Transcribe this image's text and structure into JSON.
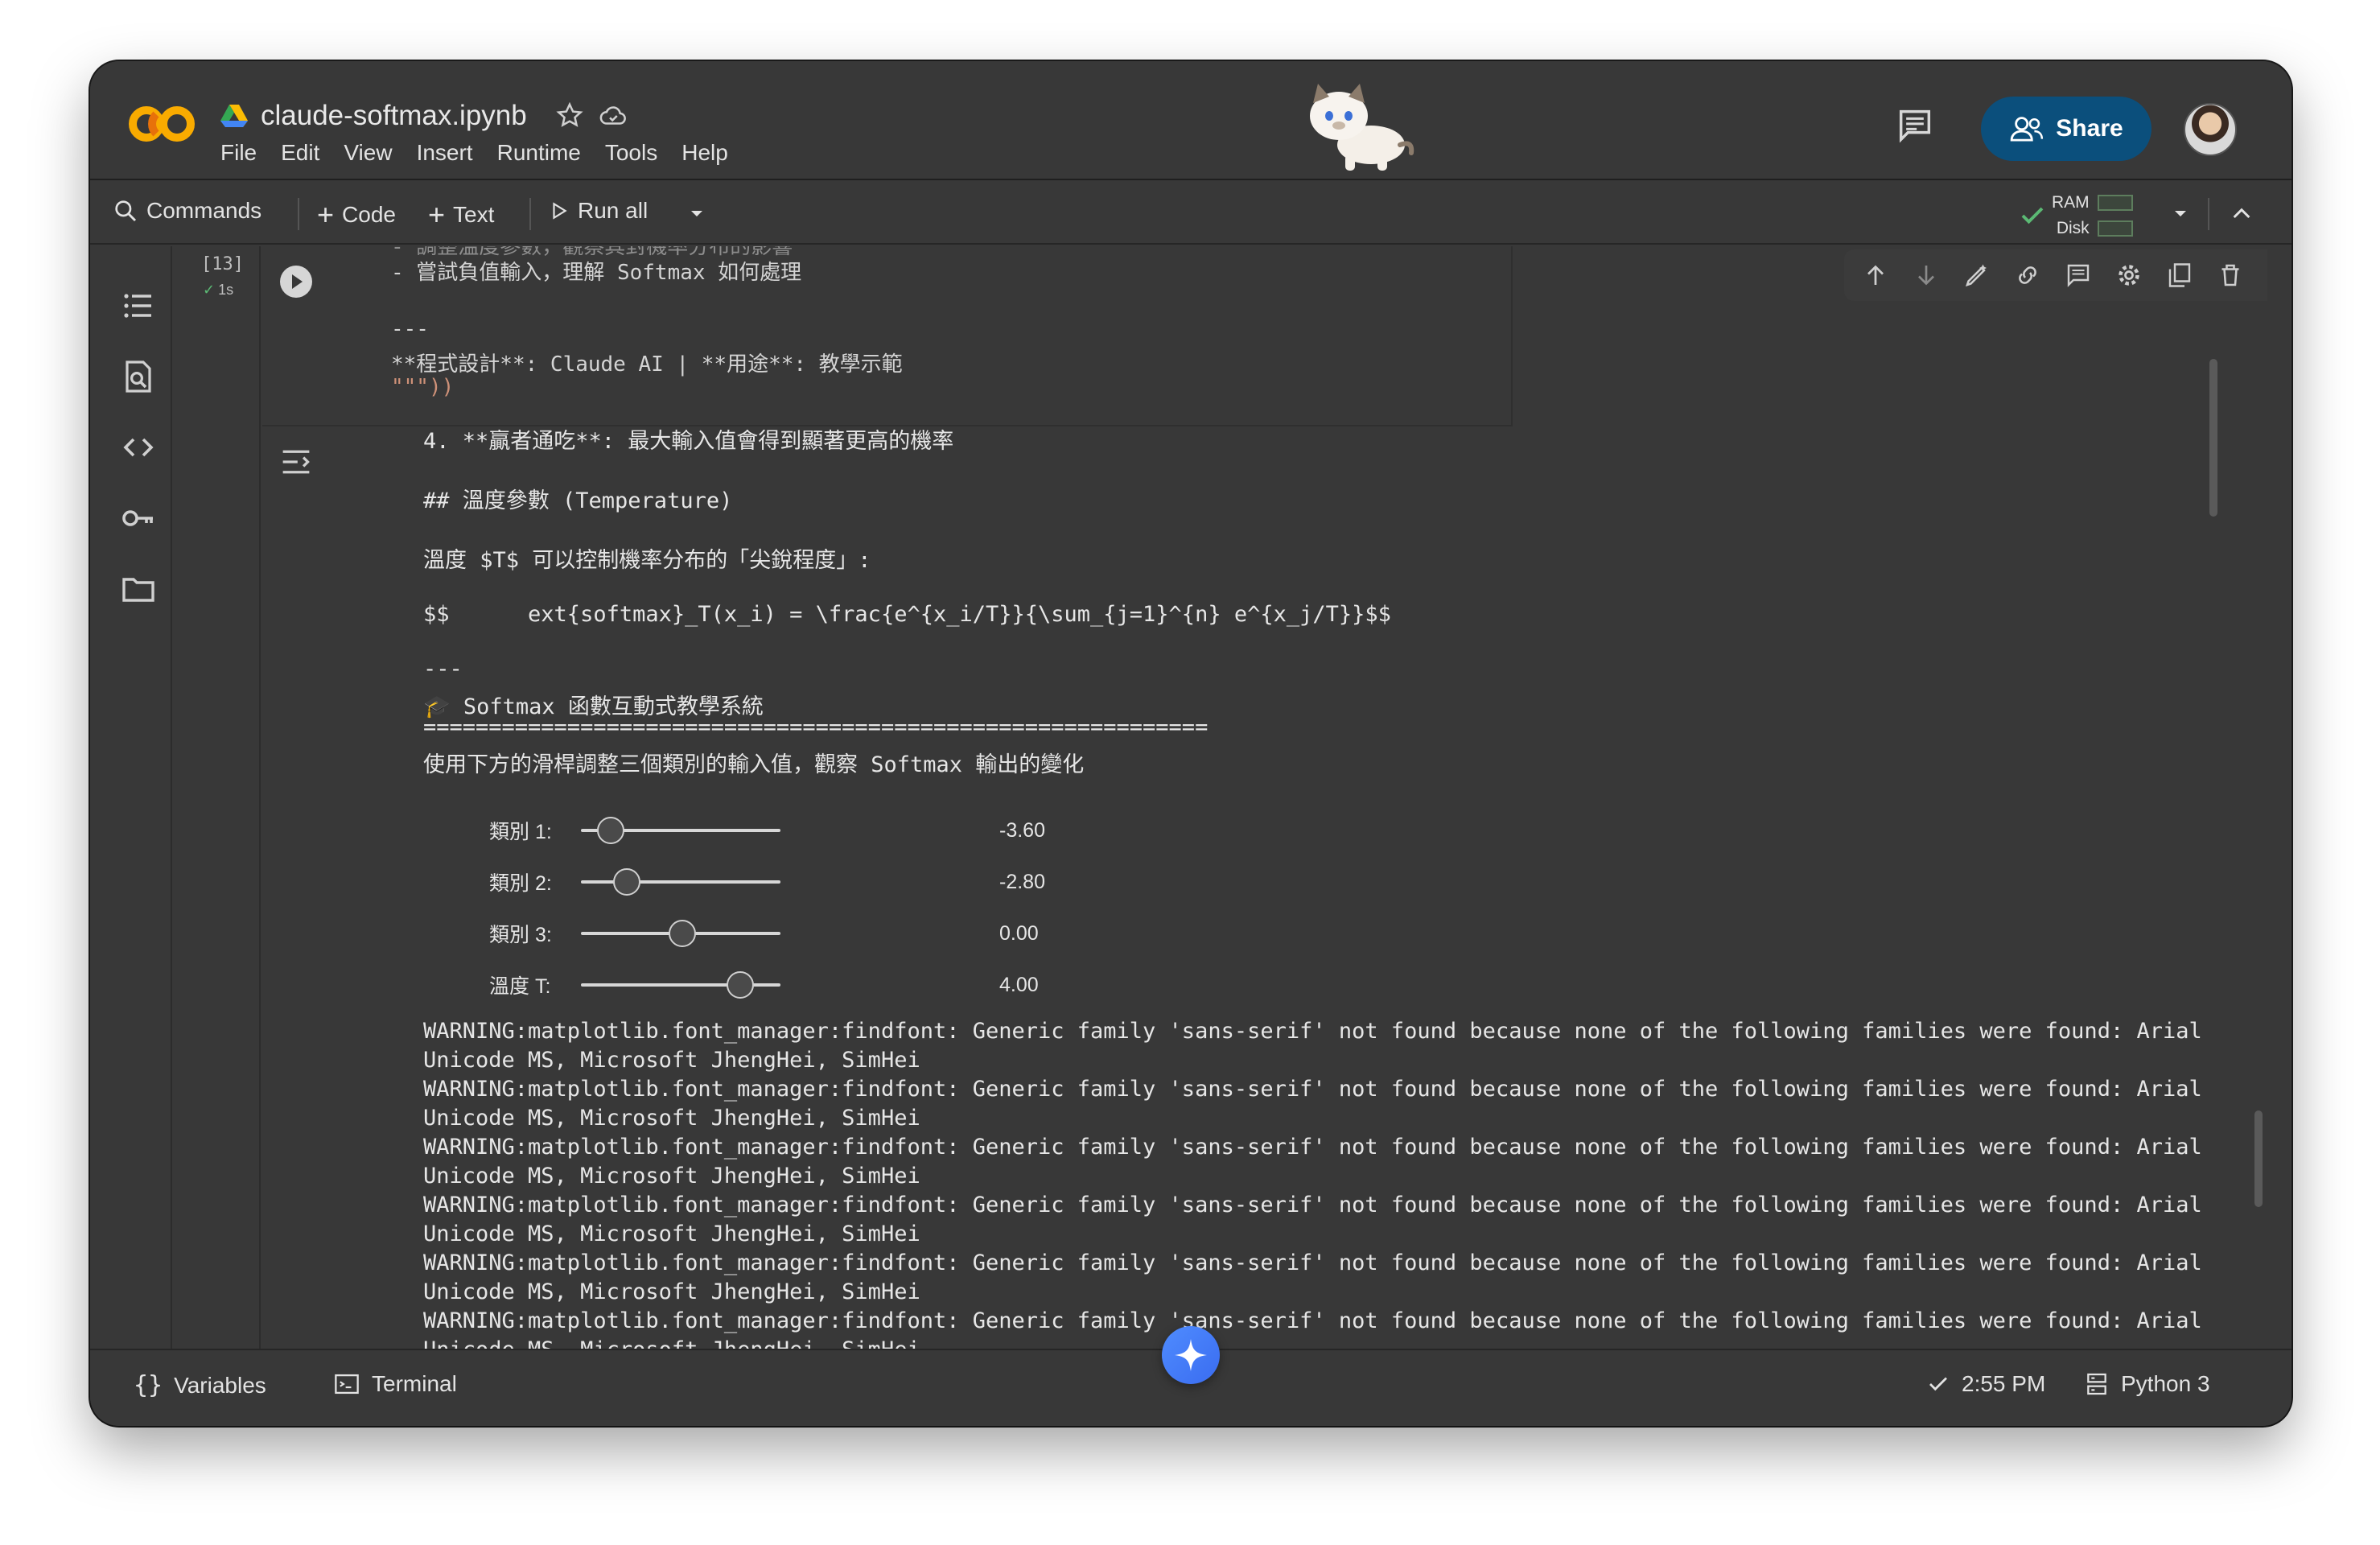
{
  "app": {
    "notebook_title": "claude-softmax.ipynb",
    "menu": [
      "File",
      "Edit",
      "View",
      "Insert",
      "Runtime",
      "Tools",
      "Help"
    ],
    "share_label": "Share"
  },
  "toolbar": {
    "commands_label": "Commands",
    "code_label": "Code",
    "text_label": "Text",
    "run_all_label": "Run all",
    "ram_label": "RAM",
    "disk_label": "Disk"
  },
  "cell": {
    "exec_count": "[13]",
    "exec_time": "1s",
    "code_lines": [
      "- 調整溫度參數，觀察其對機率分布的影響",
      "- 嘗試負值輸入，理解 Softmax 如何處理",
      "",
      "---",
      "**程式設計**: Claude AI | **用途**: 教學示範",
      "\"\"\"))"
    ]
  },
  "output": {
    "lines": [
      "4. **贏者通吃**: 最大輸入值會得到顯著更高的機率",
      "## 溫度參數 (Temperature)",
      "溫度 $T$ 可以控制機率分布的「尖銳程度」:",
      "$$      ext{softmax}_T(x_i) = \\frac{e^{x_i/T}}{\\sum_{j=1}^{n} e^{x_j/T}}$$",
      "---",
      "🎓 Softmax 函數互動式教學系統",
      "============================================================",
      "使用下方的滑桿調整三個類別的輸入值，觀察 Softmax 輸出的變化"
    ],
    "sliders": [
      {
        "label": "類別 1:",
        "value": "-3.60",
        "position": 0.15
      },
      {
        "label": "類別 2:",
        "value": "-2.80",
        "position": 0.23
      },
      {
        "label": "類別 3:",
        "value": "0.00",
        "position": 0.51
      },
      {
        "label": "溫度 T:",
        "value": "4.00",
        "position": 0.8
      }
    ],
    "warnings": [
      "WARNING:matplotlib.font_manager:findfont: Generic family 'sans-serif' not found because none of the following families were found: Arial",
      "Unicode MS, Microsoft JhengHei, SimHei",
      "WARNING:matplotlib.font_manager:findfont: Generic family 'sans-serif' not found because none of the following families were found: Arial",
      "Unicode MS, Microsoft JhengHei, SimHei",
      "WARNING:matplotlib.font_manager:findfont: Generic family 'sans-serif' not found because none of the following families were found: Arial",
      "Unicode MS, Microsoft JhengHei, SimHei",
      "WARNING:matplotlib.font_manager:findfont: Generic family 'sans-serif' not found because none of the following families were found: Arial",
      "Unicode MS, Microsoft JhengHei, SimHei",
      "WARNING:matplotlib.font_manager:findfont: Generic family 'sans-serif' not found because none of the following families were found: Arial",
      "Unicode MS, Microsoft JhengHei, SimHei",
      "WARNING:matplotlib.font_manager:findfont: Generic family 'sans-serif' not found because none of the following families were found: Arial",
      "Unicode MS, Microsoft JhengHei, SimHei"
    ]
  },
  "footer": {
    "variables_label": "Variables",
    "terminal_label": "Terminal",
    "time_label": "2:55 PM",
    "runtime_label": "Python 3"
  },
  "colors": {
    "background": "#383838",
    "share_button": "#0b4f7c",
    "logo_orange": "#f9ab00",
    "check_green": "#5bb974"
  }
}
